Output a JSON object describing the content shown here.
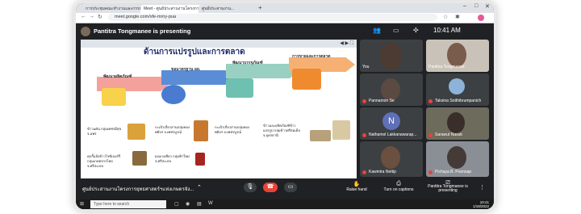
{
  "browser": {
    "tabs": [
      "การประชุมคณะทำงานและกรรมการ...",
      "Meet - ศูนย์ประสานงานโครงการ...",
      "ศูนย์ประสานงาน..."
    ],
    "new_tab": "+",
    "url": "meet.google.com/xfe-mrny-pua",
    "window_controls": [
      "–",
      "□",
      "✕"
    ]
  },
  "meet": {
    "presenter_banner": "Pantitra Tongmanee is presenting",
    "clock": "10:41 AM",
    "meeting_title": "ศูนย์ประสานงานโครงการยุทธศาสตร์ฯแห่งเกษตรจัง...",
    "bottom_actions": {
      "raise_hand": "Raise hand",
      "captions": "Turn on captions",
      "presenting": "Pantitra Tongmanee is presenting"
    }
  },
  "slide": {
    "title": "ด้านการแปรรูปและการตลาด",
    "stages": [
      "พัฒนาผลิตภัณฑ์",
      "ขอมาตรฐาน อย.",
      "พัฒนาบรรจุภัณฑ์",
      "การขายและการตลาด"
    ],
    "bullets": [
      "ข้าวแต๋น กลุ่มเพชรมีสุข จ.แพร่",
      "คุกกี้แป้งข้าวไรซ์เบอร์รี่ กลุ่มเกษตรกรไทย จ.ศรีสะเกษ",
      "กะเป้าเกี่ยวสานกลุ่มทองพยับฯ จ.เพชรบูรณ์",
      "ผงแกงเขียว กลุ่มฟ้าใหม่ จ.ศรีสะเกษ",
      "กะเป้าเกี่ยวสานกลุ่มทองพยับฯ จ.เพชรบูรณ์",
      "ข้าวและผลิตภัณฑ์ข้าวแปรรูป กลุ่มข้าวศรีสมเด็จ จ.อุดรธานี"
    ]
  },
  "participants": [
    {
      "name": "You"
    },
    {
      "name": "Pantitra Tongmanee"
    },
    {
      "name": "Pannamon Se"
    },
    {
      "name": "Taksina Sotthibrumpanich"
    },
    {
      "name": "Nathamol Lakkanawarap...",
      "initial": "N"
    },
    {
      "name": "Sarawut Nasuk"
    },
    {
      "name": "Kawintra Nettip"
    },
    {
      "name": "Pichaya B. Poonsap"
    }
  ],
  "taskbar": {
    "search_placeholder": "Type here to search",
    "time": "10:41",
    "date": "1/18/2022"
  },
  "colors": {
    "meet_bg": "#202124",
    "tile_bg": "#3c4043",
    "end_call": "#ea4335",
    "slide_title": "#1f2c6b"
  }
}
